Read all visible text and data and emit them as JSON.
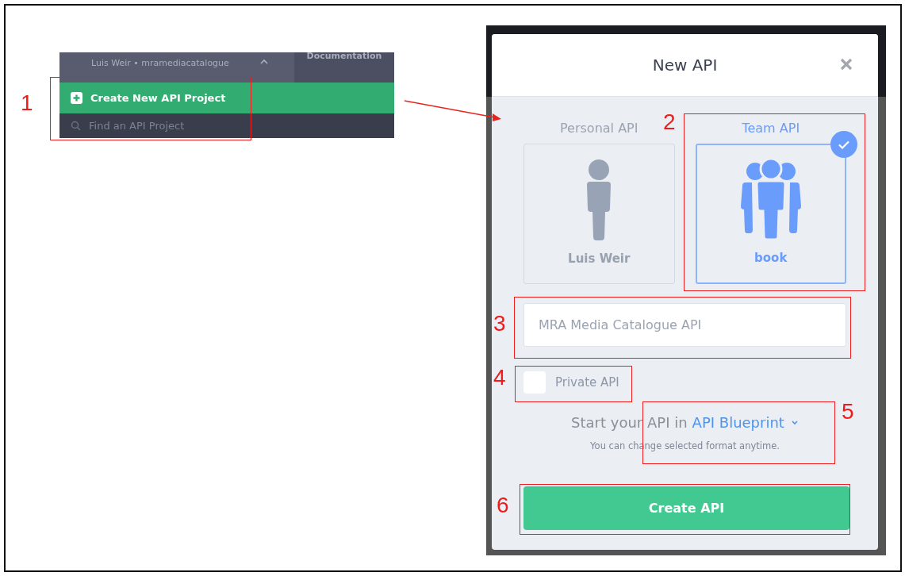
{
  "sidebar": {
    "account_line": "Luis Weir • mramediacatalogue",
    "tab": "Documentation",
    "items": [
      {
        "label": "Create New API Project",
        "kind": "create",
        "selected": true
      },
      {
        "label": "Find an API Project",
        "kind": "find",
        "selected": false
      }
    ]
  },
  "dialog": {
    "title": "New API",
    "options": [
      {
        "heading": "Personal API",
        "owner": "Luis Weir",
        "kind": "person",
        "selected": false
      },
      {
        "heading": "Team API",
        "owner": "book",
        "kind": "team",
        "selected": true
      }
    ],
    "name_field": {
      "placeholder": "MRA Media Catalogue API"
    },
    "private": {
      "label": "Private API",
      "checked": false
    },
    "format": {
      "prefix": "Start your API in",
      "choice": "API Blueprint",
      "hint": "You can change selected format anytime."
    },
    "submit": "Create API"
  },
  "annotations": [
    {
      "label": "1"
    },
    {
      "label": "2"
    },
    {
      "label": "3"
    },
    {
      "label": "4"
    },
    {
      "label": "5"
    },
    {
      "label": "6"
    }
  ]
}
